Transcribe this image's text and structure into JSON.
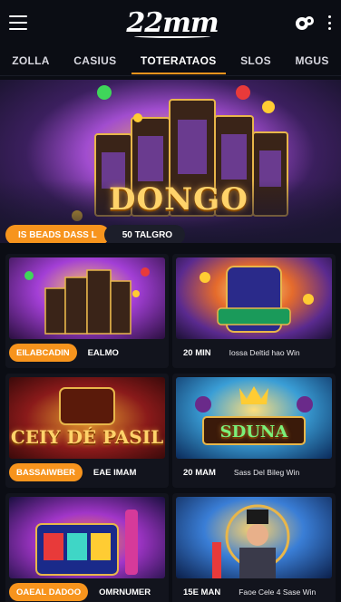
{
  "header": {
    "logo_text": "22mm",
    "menu_icon": "hamburger-menu-icon",
    "chip_icon": "casino-chip-icon",
    "more_icon": "kebab-menu-icon"
  },
  "tabs": [
    {
      "label": "ZOLLA"
    },
    {
      "label": "CASIUS"
    },
    {
      "label": "TOTERATAOS"
    },
    {
      "label": "SLOS"
    },
    {
      "label": "MGUS"
    }
  ],
  "colors": {
    "accent": "#f7941d",
    "background": "#0b0d14",
    "card": "#12141d"
  },
  "hero": {
    "title": "DONGO",
    "pill_primary": "IS BEADS DASS L",
    "pill_secondary": "50 TALGRO"
  },
  "cards": [
    {
      "pill": "EILABCADIN",
      "label": "EALMO",
      "meta": ""
    },
    {
      "pill": "",
      "label": "20 MIN",
      "meta": "Iossa Deltid hao Win"
    },
    {
      "pill": "BASSAIWBER",
      "label": "EAE IMAM",
      "meta": "",
      "art_word": "CEIY DÉ PASIL"
    },
    {
      "pill": "",
      "label": "20 MAM",
      "meta": "Sass Del Bileg Win",
      "art_word": "SDUNA"
    },
    {
      "pill": "OAEAL DADOO",
      "label": "OMRNUMER",
      "meta": ""
    },
    {
      "pill": "",
      "label": "15E MAN",
      "meta": "Faoe Cele 4 Sase Win"
    }
  ]
}
